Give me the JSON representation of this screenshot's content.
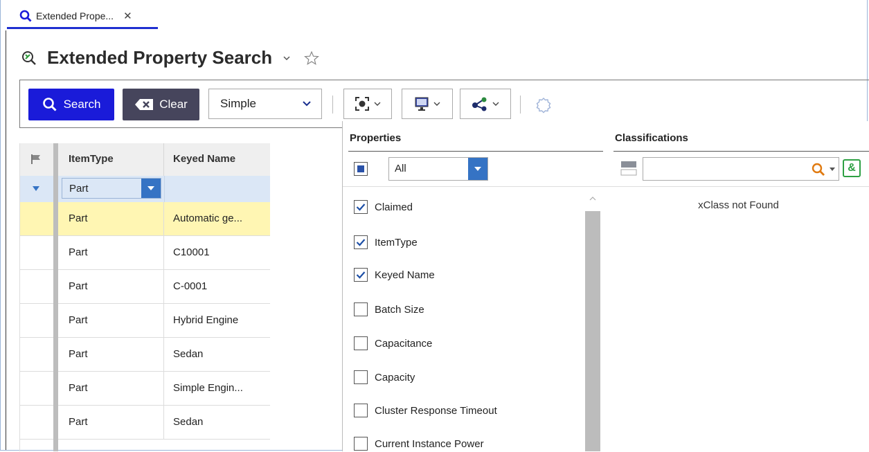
{
  "tab": {
    "label": "Extended Prope...",
    "close": "✕"
  },
  "page": {
    "title": "Extended Property Search"
  },
  "toolbar": {
    "search_label": "Search",
    "clear_label": "Clear",
    "mode_value": "Simple"
  },
  "grid": {
    "columns": [
      "ItemType",
      "Keyed Name"
    ],
    "filter": {
      "itemtype": "Part",
      "keyed_name": ""
    },
    "rows": [
      {
        "itemtype": "Part",
        "keyed_name": "Automatic ge...",
        "selected": true
      },
      {
        "itemtype": "Part",
        "keyed_name": "C10001"
      },
      {
        "itemtype": "Part",
        "keyed_name": "C-0001"
      },
      {
        "itemtype": "Part",
        "keyed_name": "Hybrid Engine"
      },
      {
        "itemtype": "Part",
        "keyed_name": "Sedan"
      },
      {
        "itemtype": "Part",
        "keyed_name": "Simple Engin..."
      },
      {
        "itemtype": "Part",
        "keyed_name": "Sedan"
      }
    ]
  },
  "properties": {
    "title": "Properties",
    "filter_value": "All",
    "items": [
      {
        "label": "Claimed",
        "checked": true
      },
      {
        "label": "ItemType",
        "checked": true
      },
      {
        "label": "Keyed Name",
        "checked": true
      },
      {
        "label": "Batch Size",
        "checked": false
      },
      {
        "label": "Capacitance",
        "checked": false
      },
      {
        "label": "Capacity",
        "checked": false
      },
      {
        "label": "Cluster Response Timeout",
        "checked": false
      },
      {
        "label": "Current Instance Power",
        "checked": false
      }
    ]
  },
  "classifications": {
    "title": "Classifications",
    "search_value": "",
    "empty_message": "xClass not Found"
  },
  "colors": {
    "search_button": "#1a1bd9",
    "clear_button": "#46455c",
    "selected_row": "#fff6b3",
    "filter_row": "#dbe7f6",
    "dropdown": "#3573c4"
  }
}
